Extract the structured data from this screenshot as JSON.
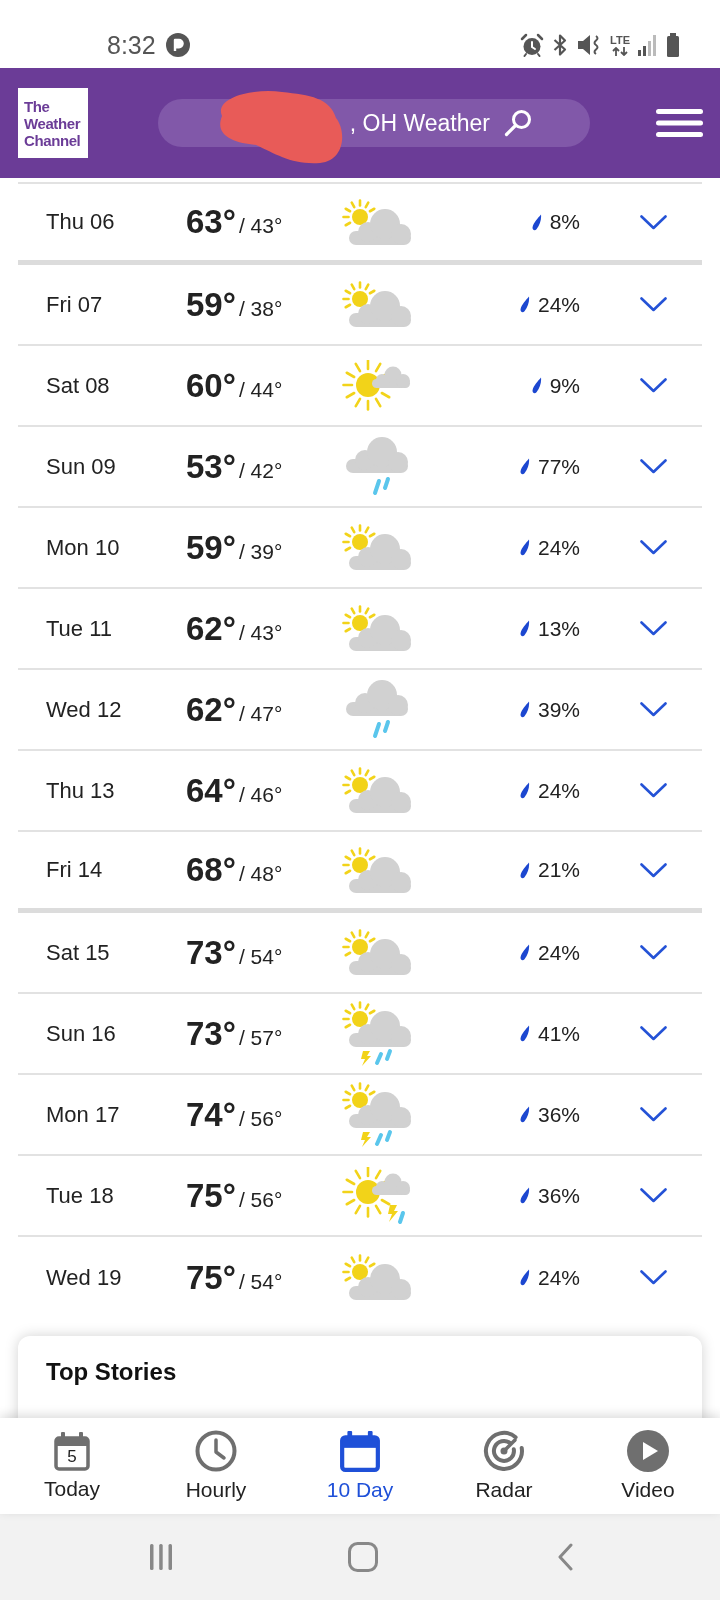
{
  "status_bar": {
    "time": "8:32",
    "network": "LTE"
  },
  "header": {
    "logo": "The Weather Channel",
    "location": ", OH Weather"
  },
  "days": [
    {
      "day": "Thu 06",
      "high": "63°",
      "low": "/ 43°",
      "kind": "partcloud",
      "precip": "8%",
      "expanded": false,
      "section_break": true
    },
    {
      "day": "Fri 07",
      "high": "59°",
      "low": "/ 38°",
      "kind": "partcloud",
      "precip": "24%",
      "expanded": false,
      "section_break": false
    },
    {
      "day": "Sat 08",
      "high": "60°",
      "low": "/ 44°",
      "kind": "mostsun",
      "precip": "9%",
      "expanded": false,
      "section_break": false
    },
    {
      "day": "Sun 09",
      "high": "53°",
      "low": "/ 42°",
      "kind": "rain",
      "precip": "77%",
      "expanded": false,
      "section_break": false
    },
    {
      "day": "Mon 10",
      "high": "59°",
      "low": "/ 39°",
      "kind": "partcloud",
      "precip": "24%",
      "expanded": false,
      "section_break": false
    },
    {
      "day": "Tue 11",
      "high": "62°",
      "low": "/ 43°",
      "kind": "partcloud",
      "precip": "13%",
      "expanded": false,
      "section_break": false
    },
    {
      "day": "Wed 12",
      "high": "62°",
      "low": "/ 47°",
      "kind": "rain",
      "precip": "39%",
      "expanded": false,
      "section_break": false
    },
    {
      "day": "Thu 13",
      "high": "64°",
      "low": "/ 46°",
      "kind": "partcloud",
      "precip": "24%",
      "expanded": false,
      "section_break": false
    },
    {
      "day": "Fri 14",
      "high": "68°",
      "low": "/ 48°",
      "kind": "partcloud",
      "precip": "21%",
      "expanded": false,
      "section_break": true
    },
    {
      "day": "Sat 15",
      "high": "73°",
      "low": "/ 54°",
      "kind": "partcloud",
      "precip": "24%",
      "expanded": false,
      "section_break": false
    },
    {
      "day": "Sun 16",
      "high": "73°",
      "low": "/ 57°",
      "kind": "tstorm",
      "precip": "41%",
      "expanded": false,
      "section_break": false
    },
    {
      "day": "Mon 17",
      "high": "74°",
      "low": "/ 56°",
      "kind": "tstorm",
      "precip": "36%",
      "expanded": false,
      "section_break": false
    },
    {
      "day": "Tue 18",
      "high": "75°",
      "low": "/ 56°",
      "kind": "suntstorm",
      "precip": "36%",
      "expanded": false,
      "section_break": false
    },
    {
      "day": "Wed 19",
      "high": "75°",
      "low": "/ 54°",
      "kind": "partcloud",
      "precip": "24%",
      "expanded": false,
      "section_break": false
    }
  ],
  "card": {
    "title": "Top Stories"
  },
  "nav": {
    "tabs": [
      {
        "label": "Today",
        "kind": "datecal",
        "icon_text": "5",
        "selected": false
      },
      {
        "label": "Hourly",
        "kind": "clock",
        "selected": false
      },
      {
        "label": "10 Day",
        "kind": "calendar",
        "selected": true
      },
      {
        "label": "Radar",
        "kind": "radar",
        "selected": false
      },
      {
        "label": "Video",
        "kind": "play",
        "selected": false
      }
    ]
  }
}
